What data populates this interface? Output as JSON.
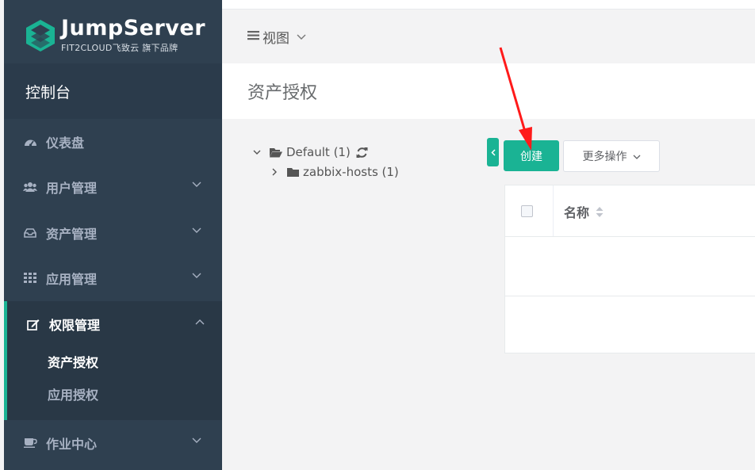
{
  "app": {
    "logo_name": "JumpServer",
    "logo_sub": "FIT2CLOUD飞致云 旗下品牌",
    "console_label": "控制台"
  },
  "sidebar": {
    "items": [
      {
        "label": "仪表盘",
        "icon": "dashboard-icon"
      },
      {
        "label": "用户管理",
        "icon": "users-icon"
      },
      {
        "label": "资产管理",
        "icon": "inbox-icon"
      },
      {
        "label": "应用管理",
        "icon": "grid-icon"
      },
      {
        "label": "权限管理",
        "icon": "edit-icon",
        "expanded": true,
        "children": [
          {
            "label": "资产授权",
            "active": true
          },
          {
            "label": "应用授权"
          }
        ]
      },
      {
        "label": "作业中心",
        "icon": "coffee-icon"
      }
    ]
  },
  "navbar": {
    "view_label": "视图"
  },
  "page": {
    "title": "资产授权"
  },
  "tree": {
    "root_label": "Default (1)",
    "child_label": "zabbix-hosts (1)"
  },
  "toolbar": {
    "create_label": "创建",
    "more_label": "更多操作"
  },
  "table": {
    "columns": [
      "名称"
    ]
  },
  "colors": {
    "sidebar_bg": "#2f4050",
    "accent": "#1ab394",
    "annotation_arrow": "#ff1a1a"
  }
}
